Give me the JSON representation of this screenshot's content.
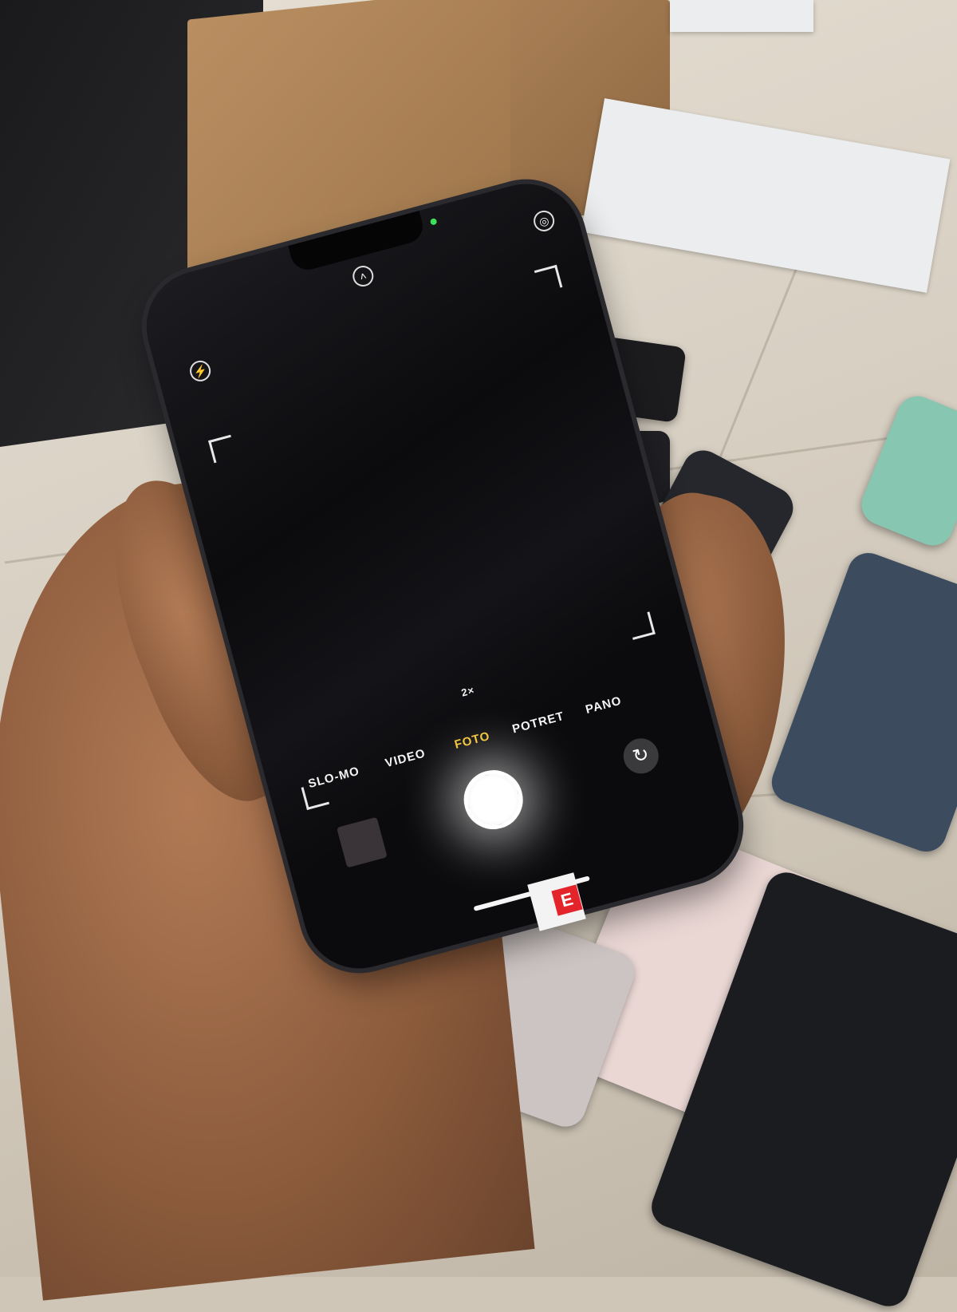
{
  "scene": {
    "description_colors": {
      "floor": "#d8d0c3",
      "phone_body": "#0b0b0d",
      "active_mode": "#f2c230"
    }
  },
  "camera_ui": {
    "zoom_label": "2×",
    "modes": [
      "SLO-MO",
      "VIDEO",
      "FOTO",
      "POTRET",
      "PANO"
    ],
    "active_mode": "FOTO",
    "icons": {
      "flash": "flash-icon",
      "live": "live-photo-icon",
      "expand": "chevron-up-icon",
      "flip": "camera-flip-icon"
    }
  },
  "sticker": {
    "label": "E"
  }
}
